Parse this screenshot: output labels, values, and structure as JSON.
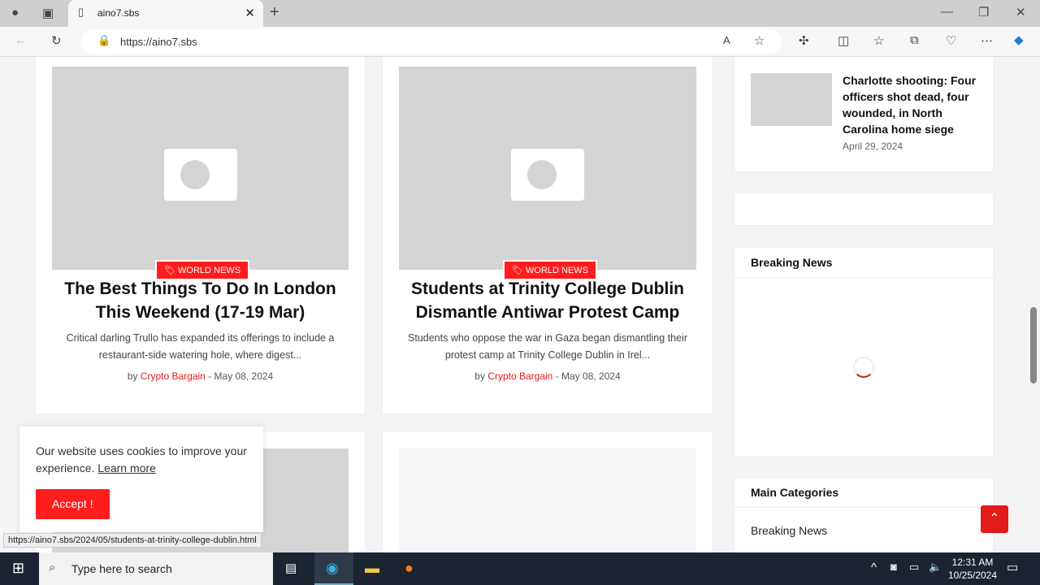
{
  "browser": {
    "tab_title": "aino7.sbs",
    "url": "https://aino7.sbs",
    "status_url": "https://aino7.sbs/2024/05/students-at-trinity-college-dublin.html"
  },
  "posts": [
    {
      "category": "WORLD NEWS",
      "title": "The Best Things To Do In London This Weekend (17-19 Mar)",
      "excerpt": "Critical darling Trullo has expanded its offerings to include a restaurant-side watering hole, where digest...",
      "by": "by",
      "author": "Crypto Bargain",
      "date": "- May 08, 2024"
    },
    {
      "category": "WORLD NEWS",
      "title": "Students at Trinity College Dublin Dismantle Antiwar Protest Camp",
      "excerpt": "Students who oppose the war in Gaza began dismantling their protest camp at Trinity College Dublin in Irel...",
      "by": "by",
      "author": "Crypto Bargain",
      "date": "- May 08, 2024"
    }
  ],
  "sidebar": {
    "recent": {
      "title": "Charlotte shooting: Four officers shot dead, four wounded, in North Carolina home siege",
      "date": "April 29, 2024"
    },
    "breaking_title": "Breaking News",
    "categories_title": "Main Categories",
    "categories": [
      "Breaking News"
    ]
  },
  "cookie": {
    "text": "Our website uses cookies to improve your experience.",
    "learn_more": "Learn more",
    "accept": "Accept !"
  },
  "taskbar": {
    "search_placeholder": "Type here to search",
    "time": "12:31 AM",
    "date": "10/25/2024"
  },
  "colors": {
    "accent": "#ff1d1d"
  }
}
